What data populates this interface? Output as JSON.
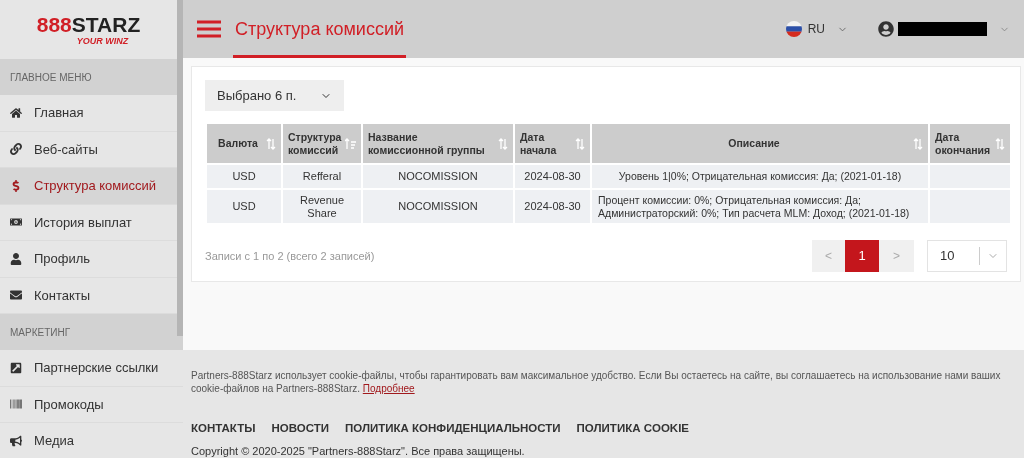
{
  "logo": {
    "mark": "888",
    "brand": "STARZ",
    "tagline": "YOUR WINZ"
  },
  "sidebar": {
    "sections": [
      {
        "title": "ГЛАВНОЕ МЕНЮ",
        "items": [
          {
            "label": "Главная",
            "selected": false
          },
          {
            "label": "Веб-сайты",
            "selected": false
          },
          {
            "label": "Структура комиссий",
            "selected": true
          },
          {
            "label": "История выплат",
            "selected": false
          },
          {
            "label": "Профиль",
            "selected": false
          },
          {
            "label": "Контакты",
            "selected": false
          }
        ]
      },
      {
        "title": "МАРКЕТИНГ",
        "items": [
          {
            "label": "Партнерские ссылки",
            "selected": false
          },
          {
            "label": "Промокоды",
            "selected": false
          },
          {
            "label": "Медиа",
            "selected": false
          }
        ]
      }
    ]
  },
  "header": {
    "title": "Структура комиссий",
    "language": "RU"
  },
  "filter": {
    "value": "Выбрано 6 п."
  },
  "table": {
    "columns": [
      {
        "label": "Валюта",
        "sorted": false
      },
      {
        "label": "Структура комиссий",
        "sorted": true
      },
      {
        "label": "Название комиссионной группы",
        "sorted": false
      },
      {
        "label": "Дата начала",
        "sorted": false
      },
      {
        "label": "Описание",
        "sorted": false
      },
      {
        "label": "Дата окончания",
        "sorted": false
      }
    ],
    "rows": [
      [
        "USD",
        "Refferal",
        "NOCOMISSION",
        "2024-08-30",
        "Уровень 1|0%; Отрицательная комиссия: Да; (2021-01-18)",
        ""
      ],
      [
        "USD",
        "Revenue Share",
        "NOCOMISSION",
        "2024-08-30",
        "Процент комиссии: 0%; Отрицательная комиссия: Да; Администраторский: 0%; Тип расчета MLM: Доход; (2021-01-18)",
        ""
      ]
    ]
  },
  "table_info": "Записи с 1 по 2 (всего 2 записей)",
  "pagination": {
    "prev": "<",
    "next": ">",
    "pages": [
      {
        "label": "1",
        "selected": true
      }
    ],
    "page_size": "10"
  },
  "footer": {
    "cookie_text": "Partners-888Starz использует cookie-файлы, чтобы гарантировать вам максимальное удобство. Если Вы остаетесь на сайте, вы соглашаетесь на использование нами ваших cookie-файлов на Partners-888Starz.",
    "cookie_link": "Подробнее",
    "links": [
      "КОНТАКТЫ",
      "НОВОСТИ",
      "ПОЛИТИКА КОНФИДЕНЦИАЛЬНОСТИ",
      "ПОЛИТИКА COOKIE"
    ],
    "copyright": "Copyright © 2020-2025 \"Partners-888Starz\". Все права защищены."
  }
}
